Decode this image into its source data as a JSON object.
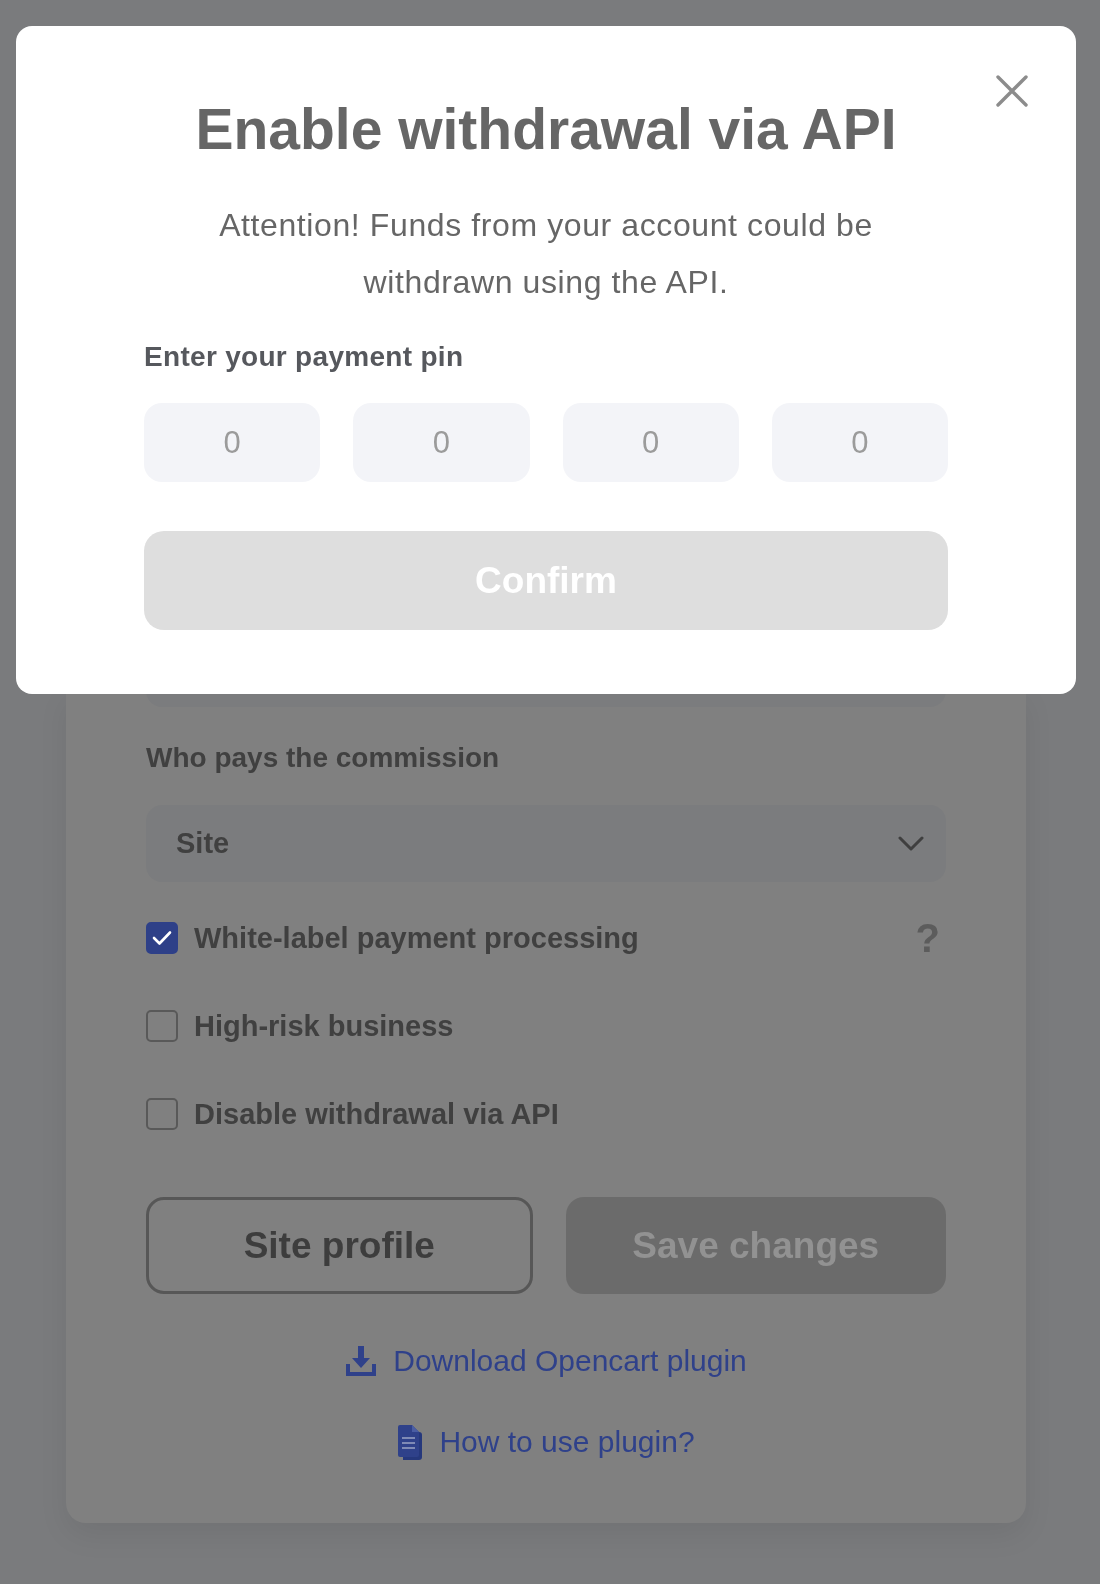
{
  "dialog": {
    "title": "Enable withdrawal via API",
    "message": "Attention! Funds from your account could be withdrawn using the API.",
    "pin_label": "Enter your payment pin",
    "pin_fields": [
      {
        "placeholder": "0"
      },
      {
        "placeholder": "0"
      },
      {
        "placeholder": "0"
      },
      {
        "placeholder": "0"
      }
    ],
    "confirm_button": {
      "label": "Confirm",
      "disabled": true
    }
  },
  "form": {
    "fields": [
      {
        "kind": "text"
      },
      {
        "kind": "select",
        "label": "Who pays the commission",
        "value": "Site"
      }
    ],
    "checkboxes": [
      {
        "label": "White-label payment processing",
        "checked": true,
        "help": "?"
      },
      {
        "label": "High-risk business",
        "checked": false
      },
      {
        "label": "Disable withdrawal via API",
        "checked": false
      }
    ],
    "buttons": [
      {
        "label": "Site profile",
        "kind": "outline",
        "disabled": false
      },
      {
        "label": "Save changes",
        "kind": "solid",
        "disabled": true
      }
    ],
    "links": [
      "Download Opencart plugin",
      "How to use plugin?"
    ]
  }
}
